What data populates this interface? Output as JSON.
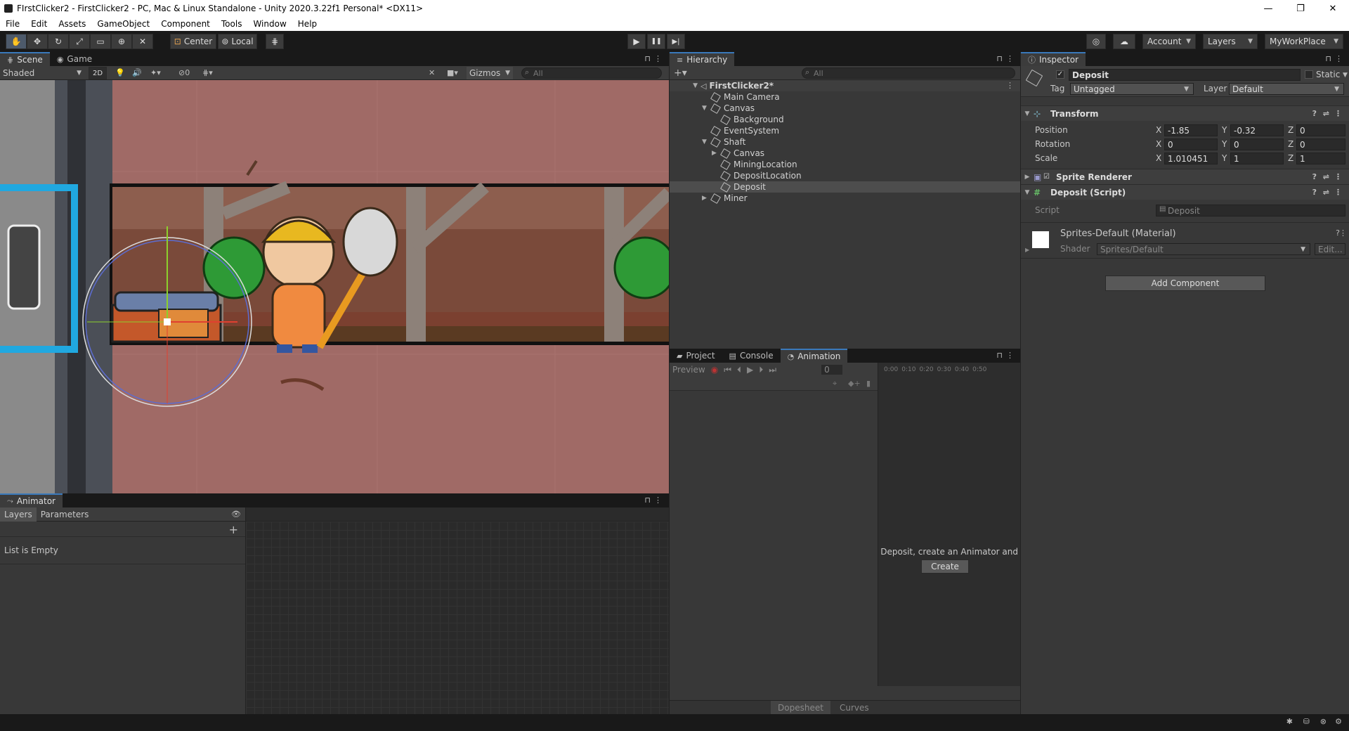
{
  "window": {
    "title": "FIrstClicker2 - FirstClicker2 - PC, Mac & Linux Standalone - Unity 2020.3.22f1 Personal* <DX11>",
    "minimize": "—",
    "maximize": "❐",
    "close": "✕"
  },
  "menu": [
    "File",
    "Edit",
    "Assets",
    "GameObject",
    "Component",
    "Tools",
    "Window",
    "Help"
  ],
  "toolbar": {
    "pivot": "Center",
    "space": "Local",
    "account": "Account",
    "layers": "Layers",
    "layout": "MyWorkPlace"
  },
  "scene": {
    "tab_scene": "Scene",
    "tab_game": "Game",
    "shading": "Shaded",
    "mode_2d": "2D",
    "hidden_count": "0",
    "gizmos": "Gizmos",
    "search_placeholder": "All"
  },
  "hierarchy": {
    "tab": "Hierarchy",
    "search_placeholder": "All",
    "items": [
      {
        "label": "FirstClicker2*",
        "depth": 0,
        "expanded": true,
        "scene": true
      },
      {
        "label": "Main Camera",
        "depth": 1
      },
      {
        "label": "Canvas",
        "depth": 1,
        "expanded": true
      },
      {
        "label": "Background",
        "depth": 2
      },
      {
        "label": "EventSystem",
        "depth": 1
      },
      {
        "label": "Shaft",
        "depth": 1,
        "expanded": true
      },
      {
        "label": "Canvas",
        "depth": 2,
        "collapsed": true
      },
      {
        "label": "MiningLocation",
        "depth": 2
      },
      {
        "label": "DepositLocation",
        "depth": 2
      },
      {
        "label": "Deposit",
        "depth": 2,
        "selected": true
      },
      {
        "label": "Miner",
        "depth": 1,
        "collapsed": true
      }
    ]
  },
  "inspector": {
    "tab": "Inspector",
    "object_name": "Deposit",
    "static_label": "Static",
    "tag_label": "Tag",
    "tag_value": "Untagged",
    "layer_label": "Layer",
    "layer_value": "Default",
    "transform": {
      "title": "Transform",
      "position_label": "Position",
      "rotation_label": "Rotation",
      "scale_label": "Scale",
      "position": {
        "x": "-1.85",
        "y": "-0.32",
        "z": "0"
      },
      "rotation": {
        "x": "0",
        "y": "0",
        "z": "0"
      },
      "scale": {
        "x": "1.010451",
        "y": "1",
        "z": "1"
      }
    },
    "sprite_renderer": "Sprite Renderer",
    "script_component": "Deposit (Script)",
    "script_label": "Script",
    "script_value": "Deposit",
    "material_name": "Sprites-Default (Material)",
    "shader_label": "Shader",
    "shader_value": "Sprites/Default",
    "edit_button": "Edit...",
    "add_component": "Add Component"
  },
  "bottom_center": {
    "tab_project": "Project",
    "tab_console": "Console",
    "tab_animation": "Animation",
    "preview": "Preview",
    "frame": "0",
    "timeline_ticks": [
      "0:00",
      "0:10",
      "0:20",
      "0:30",
      "0:40",
      "0:50"
    ],
    "message": "Deposit, create an Animator and",
    "create_button": "Create",
    "dopesheet": "Dopesheet",
    "curves": "Curves"
  },
  "animator": {
    "tab": "Animator",
    "tab_layers": "Layers",
    "tab_parameters": "Parameters",
    "empty_text": "List is Empty"
  },
  "icons": {
    "play": "▶",
    "pause": "❚❚",
    "step": "▶|",
    "plus": "+",
    "kebab": "⋮",
    "lock": "🔒"
  }
}
